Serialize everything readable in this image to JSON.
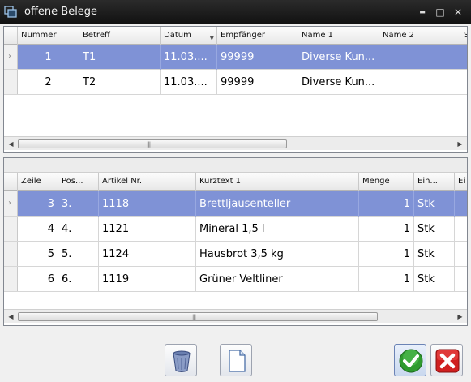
{
  "window": {
    "title": "offene Belege",
    "min_glyph": "▬",
    "max_glyph": "□",
    "close_glyph": "✕"
  },
  "top_grid": {
    "columns": [
      "Nummer",
      "Betreff",
      "Datum",
      "Empfänger",
      "Name 1",
      "Name 2",
      "S"
    ],
    "rows": [
      {
        "nummer": "1",
        "betreff": "T1",
        "datum": "11.03....",
        "empfaenger": "99999",
        "name1": "Diverse Kun...",
        "name2": "",
        "selected": true
      },
      {
        "nummer": "2",
        "betreff": "T2",
        "datum": "11.03....",
        "empfaenger": "99999",
        "name1": "Diverse Kun...",
        "name2": "",
        "selected": false
      }
    ],
    "sort_glyph": "▼",
    "scroll_grip": "|||"
  },
  "splitter": {
    "grip": "......"
  },
  "bottom_grid": {
    "columns": [
      "Zeile",
      "Pos...",
      "Artikel Nr.",
      "Kurztext 1",
      "Menge",
      "Ein...",
      "Ei"
    ],
    "rows": [
      {
        "zeile": "3",
        "pos": "3.",
        "artikel": "1118",
        "kurztext": "Brettljausenteller",
        "menge": "1",
        "einheit": "Stk",
        "selected": true
      },
      {
        "zeile": "4",
        "pos": "4.",
        "artikel": "1121",
        "kurztext": "Mineral 1,5 l",
        "menge": "1",
        "einheit": "Stk",
        "selected": false
      },
      {
        "zeile": "5",
        "pos": "5.",
        "artikel": "1124",
        "kurztext": "Hausbrot 3,5 kg",
        "menge": "1",
        "einheit": "Stk",
        "selected": false
      },
      {
        "zeile": "6",
        "pos": "6.",
        "artikel": "1119",
        "kurztext": "Grüner Veltliner",
        "menge": "1",
        "einheit": "Stk",
        "selected": false
      }
    ],
    "scroll_grip": "|||"
  },
  "icons": {
    "row_indicator": "›",
    "scroll_left": "◀",
    "scroll_right": "▶"
  },
  "colors": {
    "selection": "#7f92d6",
    "titlebar": "#1a1a1a",
    "ok_green": "#2e9a2e",
    "cancel_red": "#d02020"
  }
}
